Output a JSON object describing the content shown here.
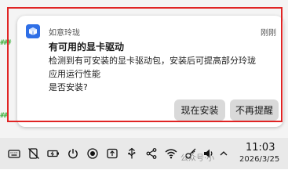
{
  "side_marks": [
    "###",
    "##"
  ],
  "notification": {
    "app_name": "如意玲珑",
    "time": "刚刚",
    "title": "有可用的显卡驱动",
    "body_lines": [
      "检测到有可安装的显卡驱动包，安装后可提高部分玲珑",
      "应用运行性能",
      "是否安装?"
    ],
    "install_button": "现在安装",
    "dismiss_button": "不再提醒",
    "app_icon": "cube-icon",
    "accent_color": "#2f6fe6"
  },
  "taskbar": {
    "tray_icons": [
      "keyboard-icon",
      "edit-off-icon",
      "battery-icon",
      "power-icon",
      "record-icon",
      "usb-icon",
      "share-icon",
      "wifi-icon",
      "key-icon",
      "volume-icon",
      "chevron-up-icon"
    ],
    "time": "11:03",
    "date": "2026/3/25"
  },
  "watermark": "公众号·小"
}
